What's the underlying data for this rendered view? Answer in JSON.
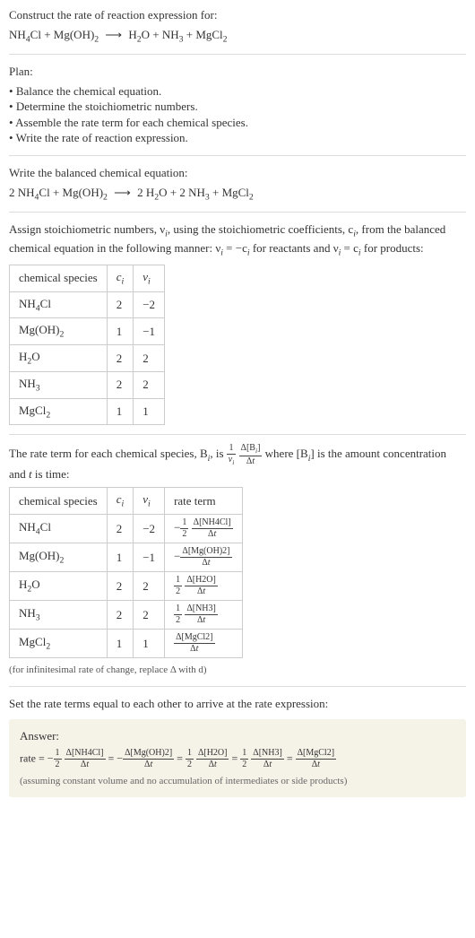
{
  "intro": {
    "line1": "Construct the rate of reaction expression for:",
    "arrow": "⟶"
  },
  "species": {
    "nh4cl": "NH",
    "nh4cl_sub1": "4",
    "nh4cl_rest": "Cl",
    "mgoh2": "Mg(OH)",
    "mgoh2_sub": "2",
    "h2o": "H",
    "h2o_sub": "2",
    "h2o_rest": "O",
    "nh3": "NH",
    "nh3_sub": "3",
    "mgcl2": "MgCl",
    "mgcl2_sub": "2"
  },
  "plan": {
    "title": "Plan:",
    "items": [
      "Balance the chemical equation.",
      "Determine the stoichiometric numbers.",
      "Assemble the rate term for each chemical species.",
      "Write the rate of reaction expression."
    ]
  },
  "balance": {
    "title": "Write the balanced chemical equation:",
    "c_nh4cl": "2 ",
    "c_h2o": "2 ",
    "c_nh3": "2 "
  },
  "assign": {
    "line1": "Assign stoichiometric numbers, ν",
    "line1_sub": "i",
    "line2": ", using the stoichiometric coefficients, c",
    "line3": ", from the balanced chemical equation in the following manner: ν",
    "line4": " = −c",
    "line5": " for reactants and ν",
    "line6": " = c",
    "line7": " for products:"
  },
  "table1": {
    "h1": "chemical species",
    "h2": "c",
    "h2_sub": "i",
    "h3": "ν",
    "h3_sub": "i",
    "rows": [
      {
        "name_key": "nh4cl",
        "c": "2",
        "v": "−2"
      },
      {
        "name_key": "mgoh2",
        "c": "1",
        "v": "−1"
      },
      {
        "name_key": "h2o",
        "c": "2",
        "v": "2"
      },
      {
        "name_key": "nh3",
        "c": "2",
        "v": "2"
      },
      {
        "name_key": "mgcl2",
        "c": "1",
        "v": "1"
      }
    ]
  },
  "rateterm": {
    "pre": "The rate term for each chemical species, B",
    "pre_sub": "i",
    "mid1": ", is ",
    "mid2": " where [B",
    "mid3": "] is the amount concentration and ",
    "mid4": " is time:"
  },
  "table2": {
    "h1": "chemical species",
    "h2": "c",
    "h2_sub": "i",
    "h3": "ν",
    "h3_sub": "i",
    "h4": "rate term",
    "rows": [
      {
        "name_key": "nh4cl",
        "c": "2",
        "v": "−2",
        "sign": "−",
        "coef_num": "1",
        "coef_den": "2",
        "delta_label": "Δ[NH4Cl]"
      },
      {
        "name_key": "mgoh2",
        "c": "1",
        "v": "−1",
        "sign": "−",
        "coef_num": "",
        "coef_den": "",
        "delta_label": "Δ[Mg(OH)2]"
      },
      {
        "name_key": "h2o",
        "c": "2",
        "v": "2",
        "sign": "",
        "coef_num": "1",
        "coef_den": "2",
        "delta_label": "Δ[H2O]"
      },
      {
        "name_key": "nh3",
        "c": "2",
        "v": "2",
        "sign": "",
        "coef_num": "1",
        "coef_den": "2",
        "delta_label": "Δ[NH3]"
      },
      {
        "name_key": "mgcl2",
        "c": "1",
        "v": "1",
        "sign": "",
        "coef_num": "",
        "coef_den": "",
        "delta_label": "Δ[MgCl2]"
      }
    ],
    "dt": "Δt",
    "note": "(for infinitesimal rate of change, replace Δ with d)"
  },
  "setline": "Set the rate terms equal to each other to arrive at the rate expression:",
  "answer": {
    "title": "Answer:",
    "rate_label": "rate = ",
    "eq": " = ",
    "terms": [
      {
        "sign": "−",
        "coef_num": "1",
        "coef_den": "2",
        "delta_label": "Δ[NH4Cl]"
      },
      {
        "sign": "−",
        "coef_num": "",
        "coef_den": "",
        "delta_label": "Δ[Mg(OH)2]"
      },
      {
        "sign": "",
        "coef_num": "1",
        "coef_den": "2",
        "delta_label": "Δ[H2O]"
      },
      {
        "sign": "",
        "coef_num": "1",
        "coef_den": "2",
        "delta_label": "Δ[NH3]"
      },
      {
        "sign": "",
        "coef_num": "",
        "coef_den": "",
        "delta_label": "Δ[MgCl2]"
      }
    ],
    "dt": "Δt",
    "note": "(assuming constant volume and no accumulation of intermediates or side products)"
  },
  "chart_data": {
    "type": "table",
    "title": "Stoichiometric numbers and rate terms",
    "tables": [
      {
        "columns": [
          "chemical species",
          "c_i",
          "ν_i"
        ],
        "rows": [
          [
            "NH4Cl",
            2,
            -2
          ],
          [
            "Mg(OH)2",
            1,
            -1
          ],
          [
            "H2O",
            2,
            2
          ],
          [
            "NH3",
            2,
            2
          ],
          [
            "MgCl2",
            1,
            1
          ]
        ]
      },
      {
        "columns": [
          "chemical species",
          "c_i",
          "ν_i",
          "rate term"
        ],
        "rows": [
          [
            "NH4Cl",
            2,
            -2,
            "-(1/2) Δ[NH4Cl]/Δt"
          ],
          [
            "Mg(OH)2",
            1,
            -1,
            "-Δ[Mg(OH)2]/Δt"
          ],
          [
            "H2O",
            2,
            2,
            "(1/2) Δ[H2O]/Δt"
          ],
          [
            "NH3",
            2,
            2,
            "(1/2) Δ[NH3]/Δt"
          ],
          [
            "MgCl2",
            1,
            1,
            "Δ[MgCl2]/Δt"
          ]
        ]
      }
    ],
    "rate_expression": "rate = -(1/2) Δ[NH4Cl]/Δt = -Δ[Mg(OH)2]/Δt = (1/2) Δ[H2O]/Δt = (1/2) Δ[NH3]/Δt = Δ[MgCl2]/Δt"
  }
}
